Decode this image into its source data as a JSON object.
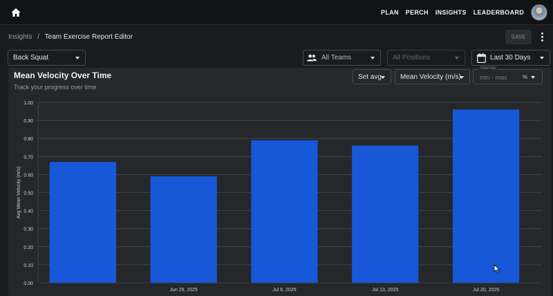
{
  "topbar": {
    "nav": [
      "PLAN",
      "PERCH",
      "INSIGHTS",
      "LEADERBOARD"
    ]
  },
  "breadcrumb": {
    "parent": "Insights",
    "separator": "/",
    "current": "Team Exercise Report Editor"
  },
  "toolbar": {
    "save_label": "SAVE"
  },
  "filters": {
    "exercise": "Back Squat",
    "teams": "All Teams",
    "positions": "All Positions",
    "date_range": "Last 30 Days"
  },
  "panel": {
    "title": "Mean Velocity Over Time",
    "subtitle": "Track your progress over time",
    "aggregate": "Set avg",
    "metric": "Mean Velocity (m/s)",
    "intensity_label": "Intensity",
    "intensity_placeholder": "min - max",
    "intensity_unit": "%"
  },
  "colors": {
    "bar": "#1658d8",
    "grid": "#4a4b50"
  },
  "chart_data": {
    "type": "bar",
    "ylabel": "Avg Mean Velocity (m/s)",
    "ylim": [
      0,
      1.0
    ],
    "yticks": [
      "0.00",
      "0.10",
      "0.20",
      "0.30",
      "0.40",
      "0.50",
      "0.60",
      "0.70",
      "0.80",
      "0.90",
      "1.00"
    ],
    "categories": [
      "",
      "Jun 29, 2025",
      "Jul 6, 2025",
      "Jul 13, 2025",
      "Jul 20, 2025"
    ],
    "values": [
      0.67,
      0.59,
      0.79,
      0.76,
      0.96
    ]
  }
}
